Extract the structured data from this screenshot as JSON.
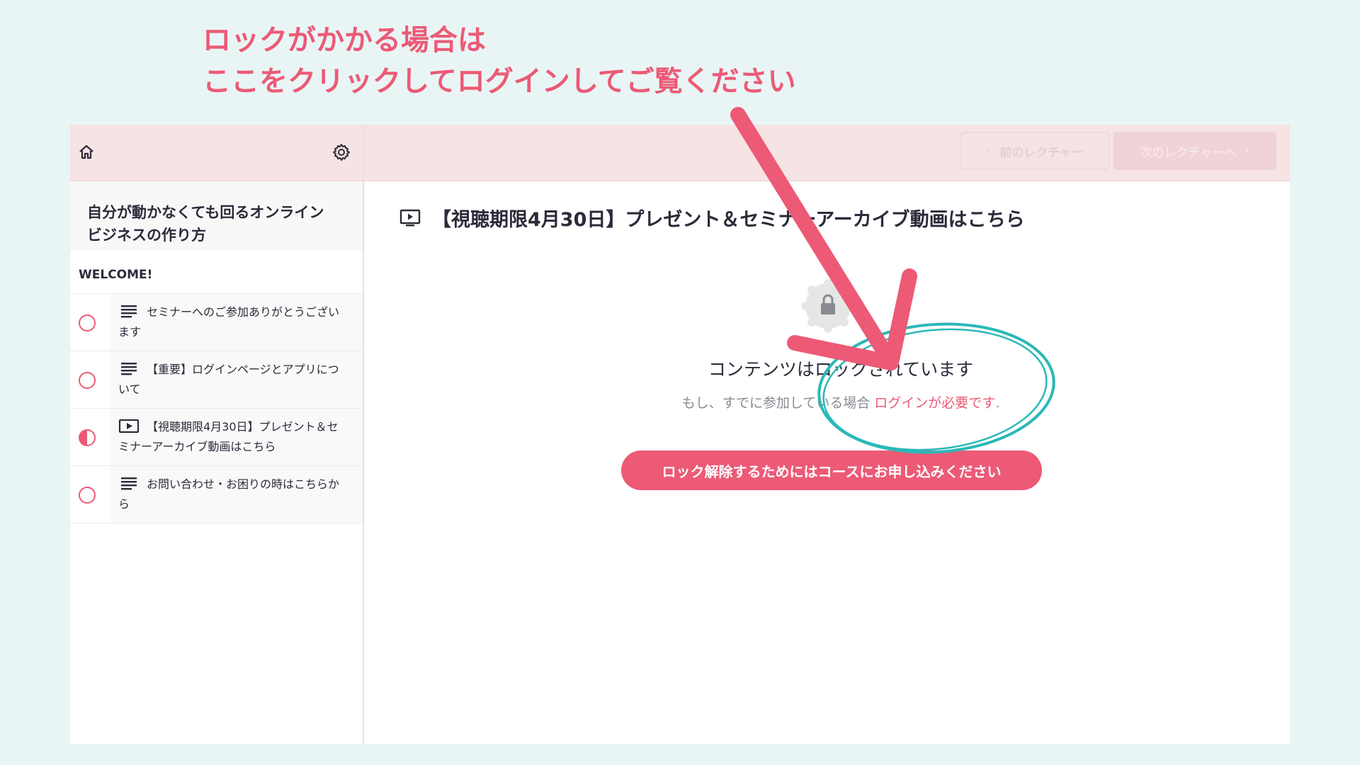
{
  "annotation": {
    "line1": "ロックがかかる場合は",
    "line2": "ここをクリックしてログインしてご覧ください"
  },
  "sidebar": {
    "home_icon": "home-icon",
    "settings_icon": "gear-icon",
    "course_title_line1": "自分が動かなくても回るオンライン",
    "course_title_line2": "ビジネスの作り方",
    "section_title": "WELCOME!",
    "lectures": [
      {
        "icon": "text-icon",
        "line1": "セミナーへのご参加ありがとうござい",
        "line2": "ます",
        "status": "not-started"
      },
      {
        "icon": "text-icon",
        "line1": "【重要】ログインページとアプリにつ",
        "line2": "いて",
        "status": "not-started"
      },
      {
        "icon": "video-icon",
        "line1": "【視聴期限4月30日】プレゼント＆セ",
        "line2": "ミナーアーカイブ動画はこちら",
        "status": "in-progress"
      },
      {
        "icon": "text-icon",
        "line1": "お問い合わせ・お困りの時はこちらか",
        "line2": "ら",
        "status": "not-started"
      }
    ]
  },
  "topbar": {
    "prev_label": "前のレクチャー",
    "next_label": "次のレクチャーへ"
  },
  "main": {
    "lecture_title": "【視聴期限4月30日】プレゼント＆セミナーアーカイブ動画はこちら",
    "locked_title": "コンテンツはロックされています",
    "locked_sub_prefix": "もし、すでに参加している場合",
    "locked_sub_link": "ログインが必要です",
    "locked_sub_suffix": ".",
    "enroll_label": "ロック解除するためにはコースにお申し込みください"
  },
  "colors": {
    "accent": "#ec5a76",
    "annotation_circle": "#2bb8b8",
    "topbar": "#f6e3e4",
    "background": "#e9f5f5"
  }
}
